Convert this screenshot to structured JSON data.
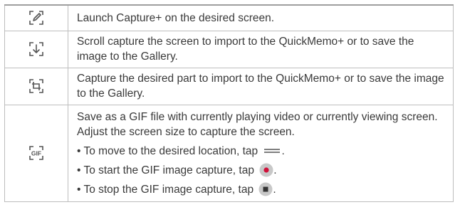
{
  "rows": [
    {
      "icon": "edit-pen-icon",
      "text": "Launch Capture+ on the desired screen."
    },
    {
      "icon": "scroll-capture-icon",
      "text": "Scroll capture the screen to import to the QuickMemo+ or to save the image to the Gallery."
    },
    {
      "icon": "crop-capture-icon",
      "text": "Capture the desired part to import to the QuickMemo+ or to save the image to the Gallery."
    },
    {
      "icon": "gif-capture-icon",
      "text": "Save as a GIF file with currently playing video or currently viewing screen. Adjust the screen size to capture the screen.",
      "bullets": [
        {
          "marker": "•",
          "text": "To move to the desired location, tap",
          "end": ".",
          "icon": "move-handle-icon"
        },
        {
          "marker": "•",
          "text": "To start the GIF image capture, tap",
          "end": ".",
          "icon": "record-button-icon"
        },
        {
          "marker": "•",
          "text": "To stop the GIF image capture, tap",
          "end": ".",
          "icon": "stop-button-icon"
        }
      ]
    }
  ],
  "icon_labels": {
    "gif": "GIF"
  },
  "colors": {
    "icon_stroke": "#555555",
    "record_red": "#d0103a",
    "button_gray": "#c8c8c8",
    "border": "#bdbdbd"
  }
}
